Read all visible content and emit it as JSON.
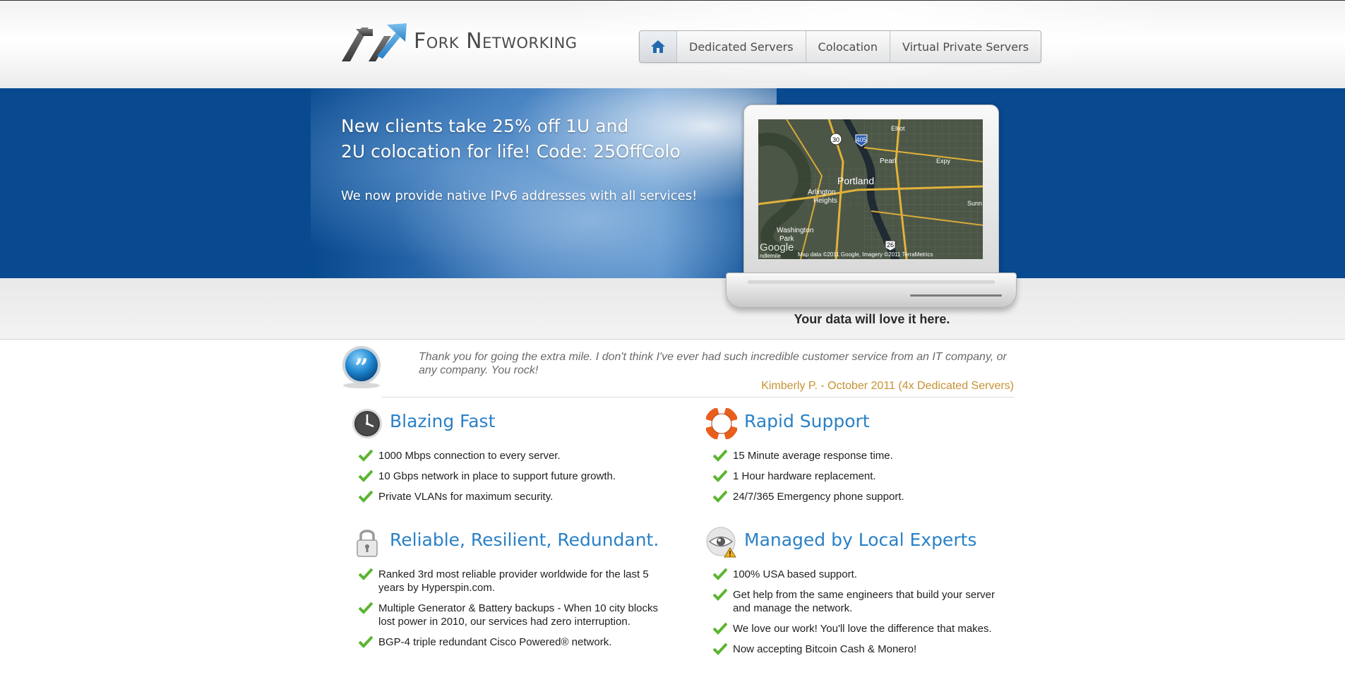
{
  "header": {
    "logo_text": "Fork Networking",
    "nav": [
      {
        "label": "Dedicated Servers"
      },
      {
        "label": "Colocation"
      },
      {
        "label": "Virtual Private Servers"
      }
    ]
  },
  "banner": {
    "promo_line1": "New clients take 25% off 1U and",
    "promo_line2": "2U colocation for life! Code: 25OffColo",
    "promo_sub": "We now provide native IPv6 addresses with all services!"
  },
  "map": {
    "labels": {
      "portland": "Portland",
      "pearl": "Pearl",
      "arlington": "Arlington",
      "heights": "Heights",
      "washington": "Washington",
      "park": "Park",
      "elliot": "Elliot",
      "expy": "Expy",
      "sunn": "Sunn",
      "ndlemile": "ndlemile",
      "google": "Google",
      "map_data": "Map data ©2011 Google, Imagery ©2011 TerraMetrics",
      "route_30": "30",
      "route_405": "405",
      "route_26": "26"
    }
  },
  "tagline": "Your data will love it here.",
  "testimonial": {
    "text": "Thank you for going the extra mile.  I don't think I've ever had such incredible customer service from an IT company, or any company.  You rock!",
    "author": "Kimberly P. - October 2011 (4x Dedicated Servers)"
  },
  "features": {
    "fast": {
      "title": "Blazing Fast",
      "items": [
        "1000 Mbps connection to every server.",
        "10 Gbps network in place to support future growth.",
        "Private VLANs for maximum security."
      ]
    },
    "support": {
      "title": "Rapid Support",
      "items": [
        "15 Minute average response time.",
        "1 Hour hardware replacement.",
        "24/7/365 Emergency phone support."
      ]
    },
    "reliable": {
      "title": "Reliable, Resilient, Redundant.",
      "items": [
        "Ranked 3rd most reliable provider worldwide for the last 5 years by Hyperspin.com.",
        "Multiple Generator & Battery backups - When 10 city blocks lost power in 2010, our services had zero interruption.",
        "BGP-4 triple redundant Cisco Powered® network."
      ]
    },
    "managed": {
      "title": "Managed by Local Experts",
      "items": [
        "100% USA based support.",
        "Get help from the same engineers that build your server and manage the network.",
        "We love our work!  You'll love the difference that makes.",
        "Now accepting Bitcoin Cash & Monero!"
      ]
    }
  },
  "colors": {
    "banner_blue": "#08498f",
    "heading_blue": "#2a81c7",
    "author_gold": "#c69232",
    "check_green": "#5cb531"
  }
}
